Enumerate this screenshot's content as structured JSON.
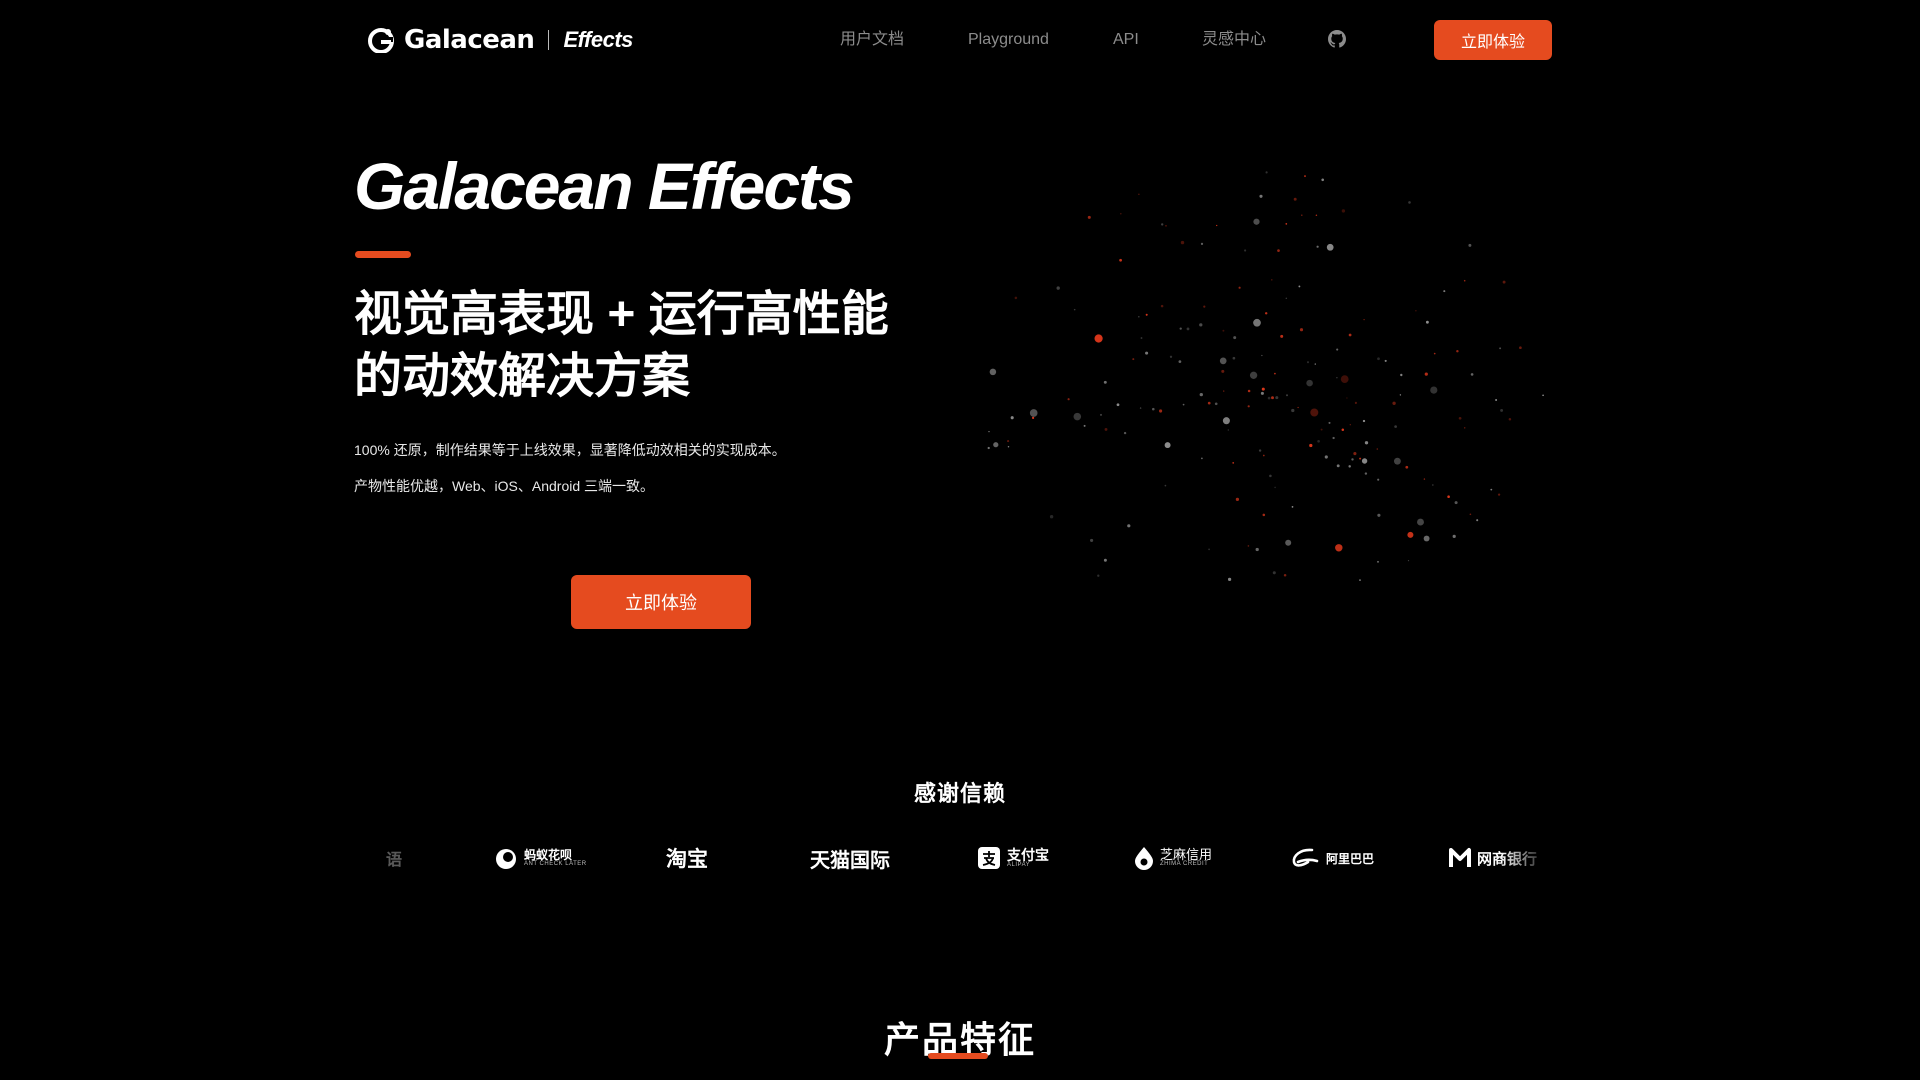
{
  "header": {
    "logo_text": "Galacean",
    "logo_sub": "Effects",
    "nav": [
      "用户文档",
      "Playground",
      "API",
      "灵感中心"
    ],
    "github_icon": "github-icon",
    "cta_label": "立即体验"
  },
  "hero": {
    "title": "Galacean Effects",
    "subtitle_line1": "视觉高表现 + 运行高性能",
    "subtitle_line2": "的动效解决方案",
    "desc1": "100% 还原，制作结果等于上线效果，显著降低动效相关的实现成本。",
    "desc2": "产物性能优越，Web、iOS、Android 三端一致。",
    "cta_label": "立即体验"
  },
  "trust": {
    "title": "感谢信赖",
    "brands": [
      {
        "name": "语",
        "icon": "partial-logo-icon"
      },
      {
        "name": "蚂蚁花呗",
        "sub": "ANT CHECK LATER",
        "icon": "huabei-icon"
      },
      {
        "name": "淘宝",
        "icon": ""
      },
      {
        "name": "天猫国际",
        "icon": ""
      },
      {
        "name": "支付宝",
        "sub": "ALIPAY",
        "icon": "alipay-icon"
      },
      {
        "name": "芝麻信用",
        "sub": "ZHIMA CREDIT",
        "icon": "zhima-icon"
      },
      {
        "name": "阿里巴巴",
        "icon": "alibaba-icon"
      },
      {
        "name": "网商银行",
        "icon": "mybank-icon"
      }
    ]
  },
  "features": {
    "title": "产品特征"
  },
  "colors": {
    "accent": "#e54b1f",
    "background": "#000000",
    "nav_text": "#8c8c8c"
  }
}
